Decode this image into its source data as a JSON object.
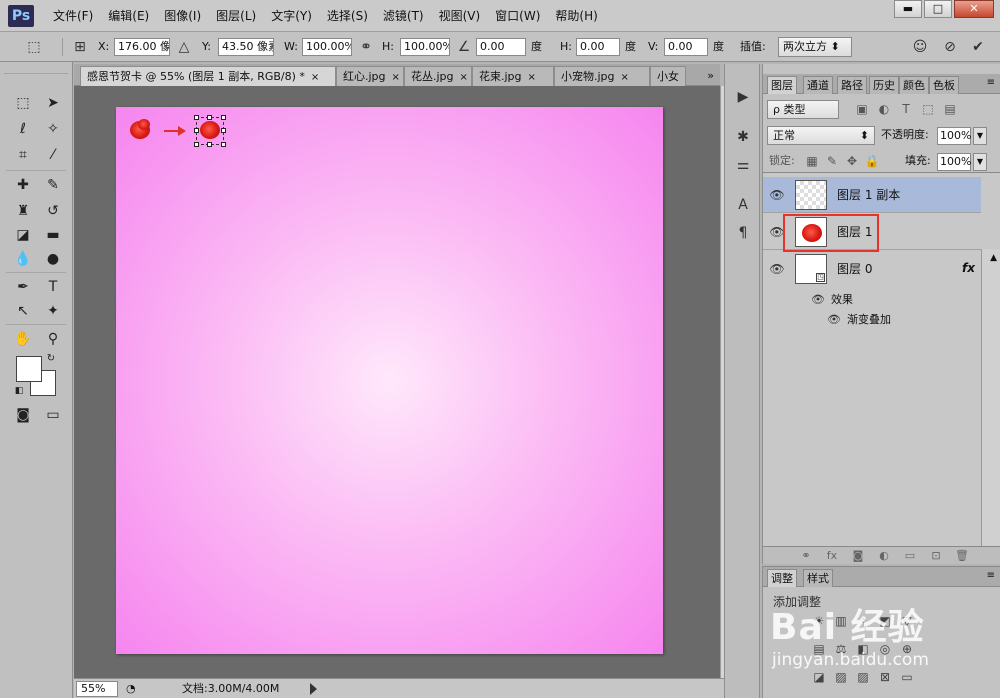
{
  "app": {
    "logo": "Ps"
  },
  "menu": [
    "文件(F)",
    "编辑(E)",
    "图像(I)",
    "图层(L)",
    "文字(Y)",
    "选择(S)",
    "滤镜(T)",
    "视图(V)",
    "窗口(W)",
    "帮助(H)"
  ],
  "window_controls": {
    "minimize": "▬",
    "maximize": "□",
    "close": "✕"
  },
  "options": {
    "x_label": "X:",
    "x_value": "176.00 像素",
    "y_label": "Y:",
    "y_value": "43.50 像素",
    "w_label": "W:",
    "w_value": "100.00%",
    "h_label": "H:",
    "h_value": "100.00%",
    "angle_value": "0.00",
    "angle_unit": "度",
    "hskew_label": "H:",
    "hskew_value": "0.00",
    "hskew_unit": "度",
    "vskew_label": "V:",
    "vskew_value": "0.00",
    "vskew_unit": "度",
    "interp_label": "插值:",
    "interp_value": "两次立方"
  },
  "doc_tabs": [
    {
      "label": "感恩节贺卡 @ 55% (图层 1 副本, RGB/8) *",
      "close": "×"
    },
    {
      "label": "红心.jpg",
      "close": "×"
    },
    {
      "label": "花丛.jpg",
      "close": "×"
    },
    {
      "label": "花束.jpg",
      "close": "×"
    },
    {
      "label": "小宠物.jpg",
      "close": "×"
    },
    {
      "label": "小女",
      "close": ""
    }
  ],
  "tabs_more": "»",
  "status": {
    "zoom": "55%",
    "doc_info": "文档:3.00M/4.00M"
  },
  "panel_tabs": [
    "图层",
    "通道",
    "路径",
    "历史",
    "颜色",
    "色板"
  ],
  "layers_panel": {
    "filter_kind": "ρ 类型",
    "blend_mode": "正常",
    "opacity_label": "不透明度:",
    "opacity_value": "100%",
    "lock_label": "锁定:",
    "fill_label": "填充:",
    "fill_value": "100%",
    "layers": [
      {
        "name": "图层 1 副本",
        "selected": true
      },
      {
        "name": "图层 1",
        "selected": false
      },
      {
        "name": "图层 0",
        "selected": false,
        "fx": "fx"
      }
    ],
    "effects_label": "效果",
    "effect_item": "渐变叠加"
  },
  "adj_tabs": [
    "调整",
    "样式"
  ],
  "adj_label": "添加调整",
  "watermark": {
    "text": "Bai 经验",
    "url": "jingyan.baidu.com"
  }
}
